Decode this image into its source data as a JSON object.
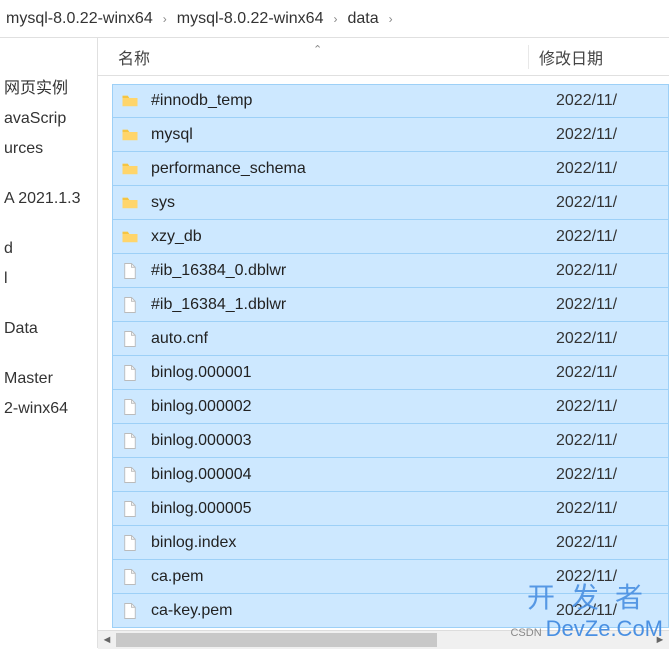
{
  "breadcrumb": {
    "seg1": "mysql-8.0.22-winx64",
    "seg2": "mysql-8.0.22-winx64",
    "seg3": "data"
  },
  "left_panel": {
    "items": [
      "网页实例",
      "avaScrip",
      "urces",
      "",
      "A 2021.1.3",
      "",
      "d",
      "l",
      "",
      "Data",
      "",
      "Master",
      "2-winx64"
    ]
  },
  "columns": {
    "name": "名称",
    "date": "修改日期"
  },
  "files": [
    {
      "name": "#innodb_temp",
      "type": "folder",
      "date": "2022/11/"
    },
    {
      "name": "mysql",
      "type": "folder",
      "date": "2022/11/"
    },
    {
      "name": "performance_schema",
      "type": "folder",
      "date": "2022/11/"
    },
    {
      "name": "sys",
      "type": "folder",
      "date": "2022/11/"
    },
    {
      "name": "xzy_db",
      "type": "folder",
      "date": "2022/11/"
    },
    {
      "name": "#ib_16384_0.dblwr",
      "type": "file",
      "date": "2022/11/"
    },
    {
      "name": "#ib_16384_1.dblwr",
      "type": "file",
      "date": "2022/11/"
    },
    {
      "name": "auto.cnf",
      "type": "file",
      "date": "2022/11/"
    },
    {
      "name": "binlog.000001",
      "type": "file",
      "date": "2022/11/"
    },
    {
      "name": "binlog.000002",
      "type": "file",
      "date": "2022/11/"
    },
    {
      "name": "binlog.000003",
      "type": "file",
      "date": "2022/11/"
    },
    {
      "name": "binlog.000004",
      "type": "file",
      "date": "2022/11/"
    },
    {
      "name": "binlog.000005",
      "type": "file",
      "date": "2022/11/"
    },
    {
      "name": "binlog.index",
      "type": "file",
      "date": "2022/11/"
    },
    {
      "name": "ca.pem",
      "type": "file",
      "date": "2022/11/"
    },
    {
      "name": "ca-key.pem",
      "type": "file",
      "date": "2022/11/"
    }
  ],
  "watermark": {
    "chinese": "开发者",
    "prefix": "CSDN",
    "brand": "DevZe.CoM"
  }
}
